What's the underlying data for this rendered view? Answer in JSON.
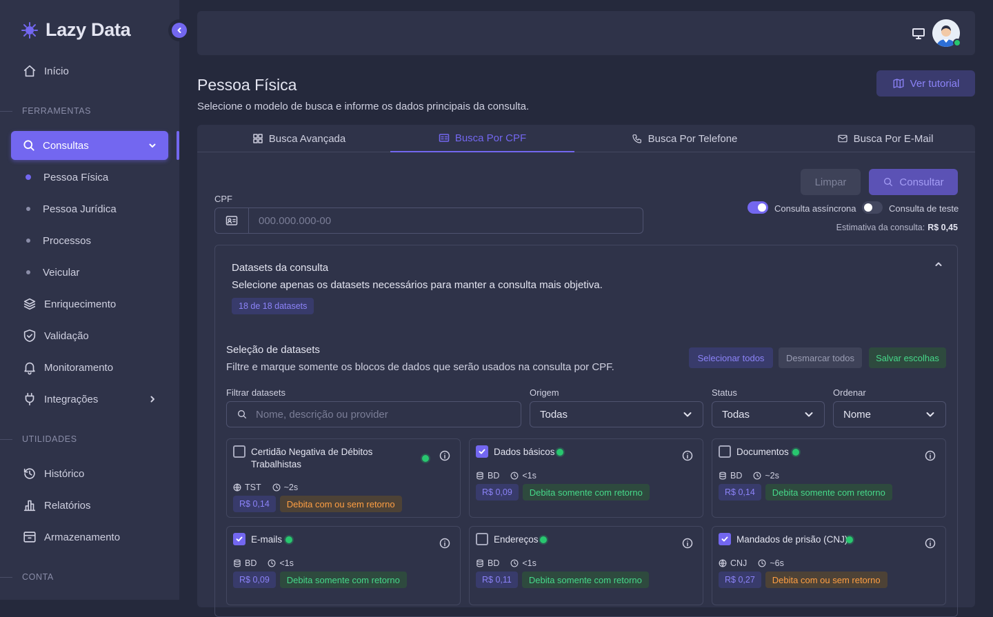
{
  "app": {
    "name": "Lazy Data"
  },
  "sidebar": {
    "home": "Início",
    "section_tools": "FERRAMENTAS",
    "consultas": "Consultas",
    "sub_items": [
      "Pessoa Física",
      "Pessoa Jurídica",
      "Processos",
      "Veicular"
    ],
    "enriquecimento": "Enriquecimento",
    "validacao": "Validação",
    "monitoramento": "Monitoramento",
    "integracoes": "Integrações",
    "section_utils": "UTILIDADES",
    "historico": "Histórico",
    "relatorios": "Relatórios",
    "armazenamento": "Armazenamento",
    "section_account": "CONTA"
  },
  "header": {
    "title": "Pessoa Física",
    "subtitle": "Selecione o modelo de busca e informe os dados principais da consulta.",
    "tutorial": "Ver tutorial"
  },
  "tabs": [
    "Busca Avançada",
    "Busca Por CPF",
    "Busca Por Telefone",
    "Busca Por E-Mail"
  ],
  "form": {
    "cpf_label": "CPF",
    "cpf_placeholder": "000.000.000-00",
    "clear": "Limpar",
    "submit": "Consultar",
    "async_label": "Consulta assíncrona",
    "test_label": "Consulta de teste",
    "estimate_label": "Estimativa da consulta:",
    "estimate_value": "R$ 0,45"
  },
  "datasets": {
    "title": "Datasets da consulta",
    "subtitle": "Selecione apenas os datasets necessários para manter a consulta mais objetiva.",
    "count": "18 de 18 datasets",
    "selection_title": "Seleção de datasets",
    "selection_subtitle": "Filtre e marque somente os blocos de dados que serão usados na consulta por CPF.",
    "select_all": "Selecionar todos",
    "deselect_all": "Desmarcar todos",
    "save": "Salvar escolhas",
    "filter_label": "Filtrar datasets",
    "filter_placeholder": "Nome, descrição ou provider",
    "origin_label": "Origem",
    "origin_value": "Todas",
    "status_label": "Status",
    "status_value": "Todas",
    "order_label": "Ordenar",
    "order_value": "Nome",
    "items": [
      {
        "name": "Certidão Negativa de Débitos Trabalhistas",
        "source": "TST",
        "time": "~2s",
        "price": "R$ 0,14",
        "debit": "Debita com ou sem retorno",
        "checked": false
      },
      {
        "name": "Dados básicos",
        "source": "BD",
        "time": "<1s",
        "price": "R$ 0,09",
        "debit": "Debita somente com retorno",
        "checked": true
      },
      {
        "name": "Documentos",
        "source": "BD",
        "time": "~2s",
        "price": "R$ 0,14",
        "debit": "Debita somente com retorno",
        "checked": false
      },
      {
        "name": "E-mails",
        "source": "BD",
        "time": "<1s",
        "price": "R$ 0,09",
        "debit": "Debita somente com retorno",
        "checked": true
      },
      {
        "name": "Endereços",
        "source": "BD",
        "time": "<1s",
        "price": "R$ 0,11",
        "debit": "Debita somente com retorno",
        "checked": false
      },
      {
        "name": "Mandados de prisão (CNJ)",
        "source": "CNJ",
        "time": "~6s",
        "price": "R$ 0,27",
        "debit": "Debita com ou sem retorno",
        "checked": true
      }
    ]
  },
  "colors": {
    "primary": "#7367f0",
    "success": "#28c76f",
    "warning": "#ff9f43",
    "sidebar_bg": "#2f3349",
    "page_bg": "#25293c"
  }
}
